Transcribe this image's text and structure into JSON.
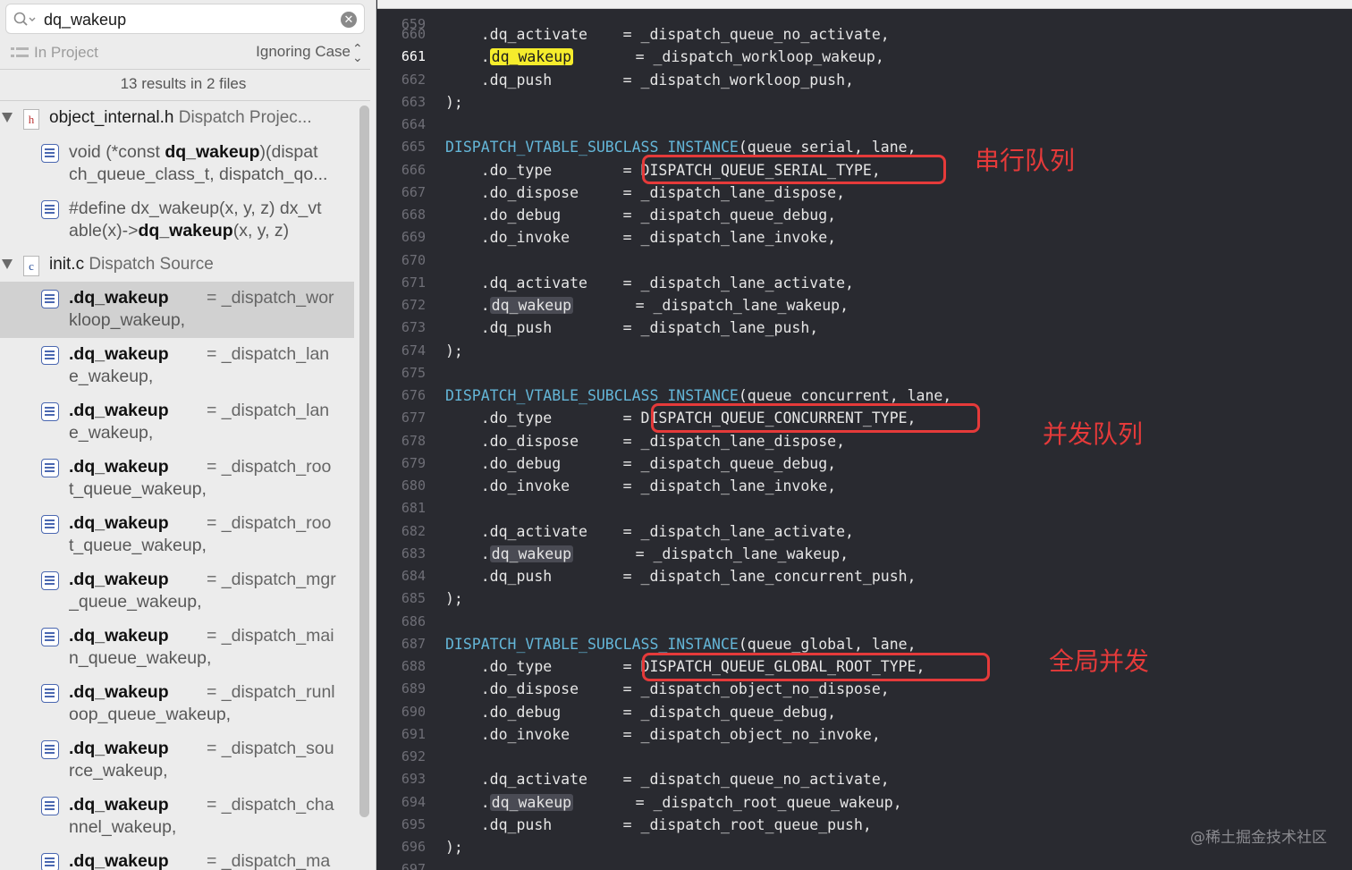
{
  "search": {
    "query": "dq_wakeup",
    "scope": "In Project",
    "case_mode": "Ignoring Case",
    "summary": "13 results in 2 files"
  },
  "files": [
    {
      "name": "object_internal.h",
      "path": "Dispatch Projec...",
      "icon_letter": "h",
      "results": [
        {
          "l1_pre": "void (*const ",
          "l1_match": "dq_wakeup",
          "l1_post": ")(dispat",
          "l2": "ch_queue_class_t, dispatch_qo..."
        },
        {
          "l1_pre": "#define dx_wakeup(x, y, z) dx_vt",
          "l1_match": "",
          "l1_post": "",
          "l2_pre": "able(x)->",
          "l2_match": "dq_wakeup",
          "l2_post": "(x, y, z)"
        }
      ]
    },
    {
      "name": "init.c",
      "path": "Dispatch Source",
      "icon_letter": "c",
      "results": [
        {
          "match": ".dq_wakeup",
          "rhs": "= _dispatch_wor",
          "l2": "kloop_wakeup,"
        },
        {
          "match": ".dq_wakeup",
          "rhs": "= _dispatch_lan",
          "l2": "e_wakeup,"
        },
        {
          "match": ".dq_wakeup",
          "rhs": "= _dispatch_lan",
          "l2": "e_wakeup,"
        },
        {
          "match": ".dq_wakeup",
          "rhs": "= _dispatch_roo",
          "l2": "t_queue_wakeup,"
        },
        {
          "match": ".dq_wakeup",
          "rhs": "= _dispatch_roo",
          "l2": "t_queue_wakeup,"
        },
        {
          "match": ".dq_wakeup",
          "rhs": "= _dispatch_mgr",
          "l2": "_queue_wakeup,"
        },
        {
          "match": ".dq_wakeup",
          "rhs": "= _dispatch_mai",
          "l2": "n_queue_wakeup,"
        },
        {
          "match": ".dq_wakeup",
          "rhs": "= _dispatch_runl",
          "l2": "oop_queue_wakeup,"
        },
        {
          "match": ".dq_wakeup",
          "rhs": "= _dispatch_sou",
          "l2": "rce_wakeup,"
        },
        {
          "match": ".dq_wakeup",
          "rhs": "= _dispatch_cha",
          "l2": "nnel_wakeup,"
        },
        {
          "match": ".dq_wakeup",
          "rhs": "= _dispatch_ma",
          "l2": ""
        }
      ]
    }
  ],
  "code": {
    "top_partial_line": "659",
    "current_line": "661",
    "lines": [
      {
        "n": "660",
        "text": "    .dq_activate    = _dispatch_queue_no_activate,"
      },
      {
        "n": "661",
        "pre": "    .",
        "hl": "dq_wakeup",
        "hl_kind": "current",
        "post": "       = _dispatch_workloop_wakeup,"
      },
      {
        "n": "662",
        "text": "    .dq_push        = _dispatch_workloop_push,"
      },
      {
        "n": "663",
        "text": ");"
      },
      {
        "n": "664",
        "text": ""
      },
      {
        "n": "665",
        "macro": "DISPATCH_VTABLE_SUBCLASS_INSTANCE",
        "text": "(queue_serial, lane,"
      },
      {
        "n": "666",
        "text": "    .do_type        = DISPATCH_QUEUE_SERIAL_TYPE,"
      },
      {
        "n": "667",
        "text": "    .do_dispose     = _dispatch_lane_dispose,"
      },
      {
        "n": "668",
        "text": "    .do_debug       = _dispatch_queue_debug,"
      },
      {
        "n": "669",
        "text": "    .do_invoke      = _dispatch_lane_invoke,"
      },
      {
        "n": "670",
        "text": ""
      },
      {
        "n": "671",
        "text": "    .dq_activate    = _dispatch_lane_activate,"
      },
      {
        "n": "672",
        "pre": "    .",
        "hl": "dq_wakeup",
        "hl_kind": "other",
        "post": "       = _dispatch_lane_wakeup,"
      },
      {
        "n": "673",
        "text": "    .dq_push        = _dispatch_lane_push,"
      },
      {
        "n": "674",
        "text": ");"
      },
      {
        "n": "675",
        "text": ""
      },
      {
        "n": "676",
        "macro": "DISPATCH_VTABLE_SUBCLASS_INSTANCE",
        "text": "(queue_concurrent, lane,"
      },
      {
        "n": "677",
        "text": "    .do_type        = DISPATCH_QUEUE_CONCURRENT_TYPE,"
      },
      {
        "n": "678",
        "text": "    .do_dispose     = _dispatch_lane_dispose,"
      },
      {
        "n": "679",
        "text": "    .do_debug       = _dispatch_queue_debug,"
      },
      {
        "n": "680",
        "text": "    .do_invoke      = _dispatch_lane_invoke,"
      },
      {
        "n": "681",
        "text": ""
      },
      {
        "n": "682",
        "text": "    .dq_activate    = _dispatch_lane_activate,"
      },
      {
        "n": "683",
        "pre": "    .",
        "hl": "dq_wakeup",
        "hl_kind": "other",
        "post": "       = _dispatch_lane_wakeup,"
      },
      {
        "n": "684",
        "text": "    .dq_push        = _dispatch_lane_concurrent_push,"
      },
      {
        "n": "685",
        "text": ");"
      },
      {
        "n": "686",
        "text": ""
      },
      {
        "n": "687",
        "macro": "DISPATCH_VTABLE_SUBCLASS_INSTANCE",
        "text": "(queue_global, lane,"
      },
      {
        "n": "688",
        "text": "    .do_type        = DISPATCH_QUEUE_GLOBAL_ROOT_TYPE,"
      },
      {
        "n": "689",
        "text": "    .do_dispose     = _dispatch_object_no_dispose,"
      },
      {
        "n": "690",
        "text": "    .do_debug       = _dispatch_queue_debug,"
      },
      {
        "n": "691",
        "text": "    .do_invoke      = _dispatch_object_no_invoke,"
      },
      {
        "n": "692",
        "text": ""
      },
      {
        "n": "693",
        "text": "    .dq_activate    = _dispatch_queue_no_activate,"
      },
      {
        "n": "694",
        "pre": "    .",
        "hl": "dq_wakeup",
        "hl_kind": "other",
        "post": "       = _dispatch_root_queue_wakeup,"
      },
      {
        "n": "695",
        "text": "    .dq_push        = _dispatch_root_queue_push,"
      },
      {
        "n": "696",
        "text": ");"
      },
      {
        "n": "697",
        "text": ""
      }
    ]
  },
  "annotations": {
    "serial": "串行队列",
    "concurrent": "并发队列",
    "global": "全局并发"
  },
  "watermark": "@稀土掘金技术社区",
  "colors": {
    "annotation_red": "#e53a3a",
    "current_match_highlight": "#f5ec2c",
    "macro_blue": "#64b6d8",
    "editor_bg": "#292a30"
  }
}
